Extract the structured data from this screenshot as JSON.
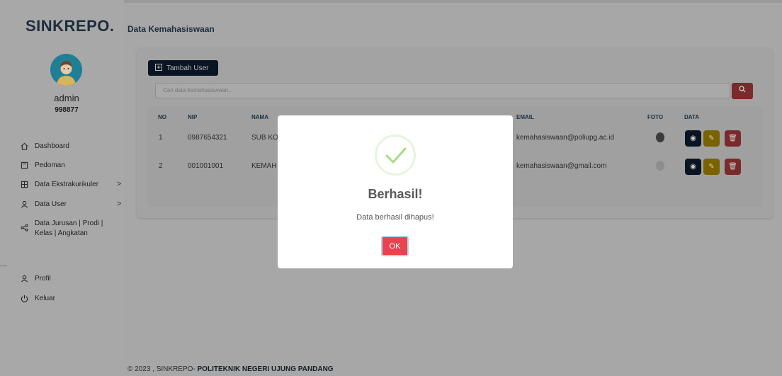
{
  "app": {
    "brand": "SINKREPO."
  },
  "user": {
    "name": "admin",
    "id": "998877"
  },
  "sidebar": {
    "items": [
      {
        "label": "Dashboard",
        "icon": "home-icon"
      },
      {
        "label": "Pedoman",
        "icon": "book-icon"
      },
      {
        "label": "Data Ekstrakurikuler",
        "icon": "grid-icon",
        "chevron": ">"
      },
      {
        "label": "Data User",
        "icon": "user-icon",
        "chevron": ">"
      },
      {
        "label": "Data Jurusan | Prodi |",
        "label2": "Kelas | Angkatan",
        "icon": "share-icon"
      },
      {
        "label": "Profil",
        "icon": "user-icon"
      },
      {
        "label": "Keluar",
        "icon": "power-icon"
      }
    ]
  },
  "page": {
    "title": "Data Kemahasiswaan",
    "add_button": "Tambah User",
    "search_placeholder": "Cari data kemahasiswaan..."
  },
  "table": {
    "columns": [
      "NO",
      "NIP",
      "NAMA",
      "EMAIL",
      "FOTO",
      "DATA"
    ],
    "rows": [
      {
        "no": "1",
        "nip": "0987654321",
        "nama": "SUB KO",
        "email": "kemahasiswaan@poliupg.ac.id"
      },
      {
        "no": "2",
        "nip": "001001001",
        "nama": "KEMAH",
        "email": "kemahasiswaan@gmail.com"
      }
    ]
  },
  "modal": {
    "title": "Berhasil!",
    "text": "Data berhasil dihapus!",
    "ok_label": "OK"
  },
  "footer": {
    "prefix": "© 2023 , SINKREPO- ",
    "bold": "POLITEKNIK NEGERI UJUNG PANDANG"
  },
  "colors": {
    "accent_dark": "#0a1523",
    "danger": "#e8434f",
    "warning": "#d9a400",
    "success_check": "#a5dc86"
  }
}
